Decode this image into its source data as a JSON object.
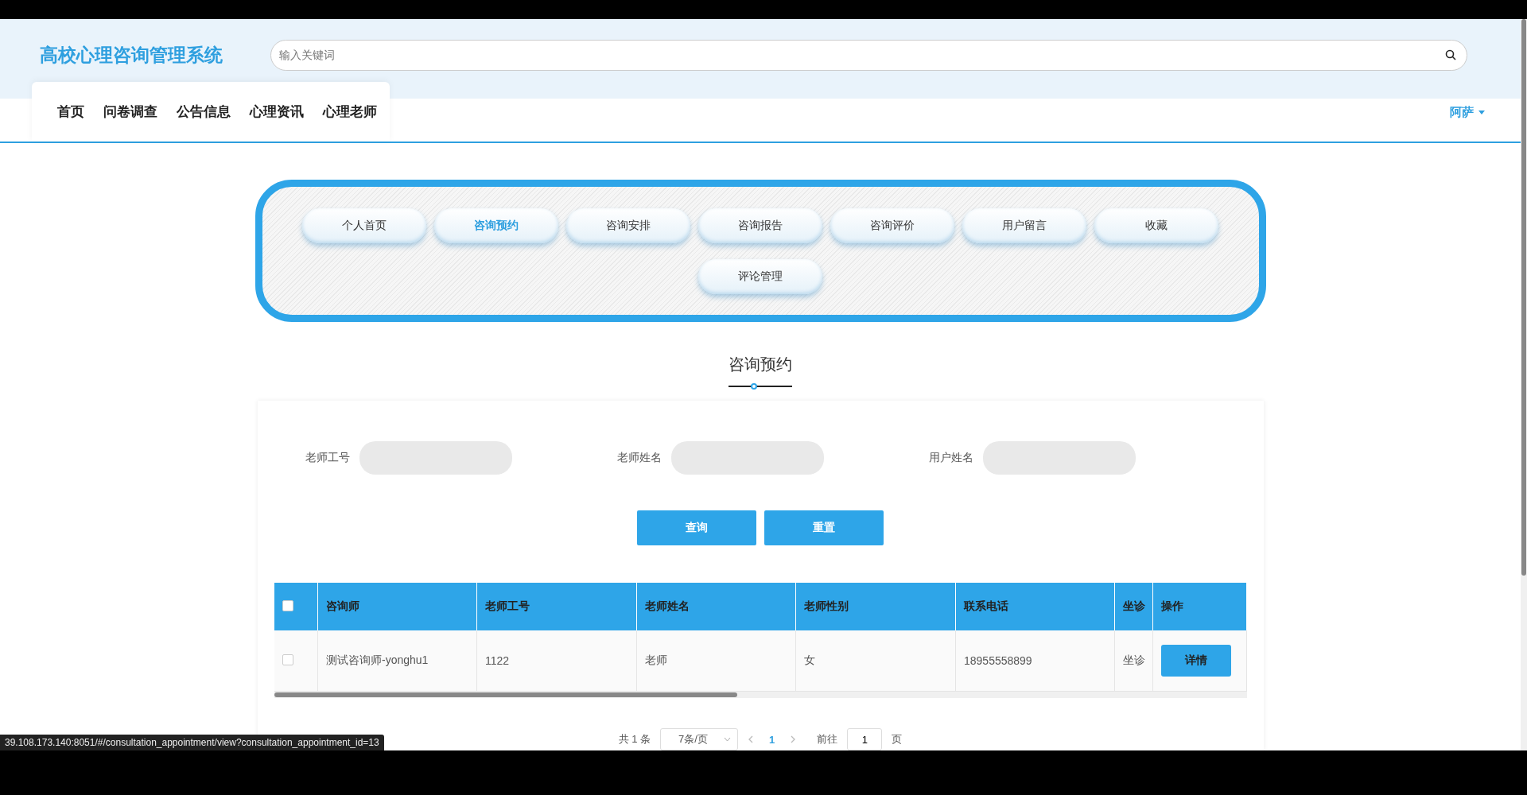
{
  "header": {
    "logo": "高校心理咨询管理系统",
    "search": {
      "placeholder": "输入关键词"
    }
  },
  "nav": {
    "items": [
      "首页",
      "问卷调查",
      "公告信息",
      "心理资讯",
      "心理老师"
    ],
    "user": "阿萨"
  },
  "menu": [
    {
      "label": "个人首页",
      "selected": false
    },
    {
      "label": "咨询预约",
      "selected": true
    },
    {
      "label": "咨询安排",
      "selected": false
    },
    {
      "label": "咨询报告",
      "selected": false
    },
    {
      "label": "咨询评价",
      "selected": false
    },
    {
      "label": "用户留言",
      "selected": false
    },
    {
      "label": "收藏",
      "selected": false
    },
    {
      "label": "评论管理",
      "selected": false
    }
  ],
  "section_title": "咨询预约",
  "filters": [
    {
      "label": "老师工号"
    },
    {
      "label": "老师姓名"
    },
    {
      "label": "用户姓名"
    }
  ],
  "buttons": [
    "查询",
    "重置"
  ],
  "table": {
    "select_all_checked": false,
    "columns": [
      "咨询师",
      "老师工号",
      "老师姓名",
      "老师性别",
      "联系电话",
      "坐诊"
    ],
    "action_column": "操作",
    "rows": [
      {
        "checked": false,
        "cells": [
          "测试咨询师-yonghu1",
          "1122",
          "老师",
          "女",
          "18955558899",
          "坐诊"
        ],
        "action": "详情"
      }
    ]
  },
  "pagination": {
    "total": "共 1 条",
    "page_size": "7条/页",
    "pages": [
      {
        "label": "1",
        "selected": true
      }
    ],
    "goto_label": "前往",
    "goto_value": "1",
    "page_suffix": "页"
  },
  "status_bar": "39.108.173.140:8051/#/consultation_appointment/view?consultation_appointment_id=13"
}
